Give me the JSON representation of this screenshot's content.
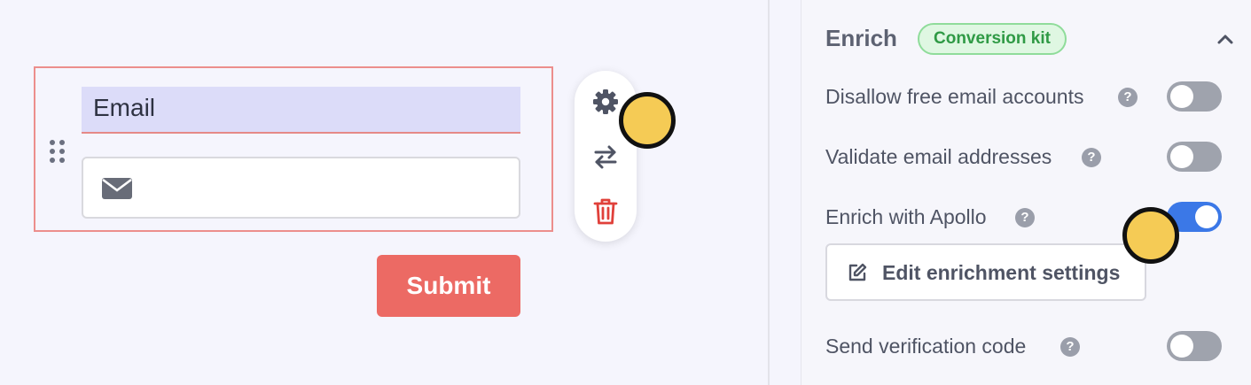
{
  "form": {
    "field_label": "Email",
    "input_value": "",
    "submit_label": "Submit"
  },
  "toolbar": {
    "icons": [
      "gear-icon",
      "swap-icon",
      "trash-icon"
    ]
  },
  "panel": {
    "title": "Enrich",
    "badge": "Conversion kit",
    "options": [
      {
        "label": "Disallow free email accounts",
        "help": "?",
        "enabled": false
      },
      {
        "label": "Validate email addresses",
        "help": "?",
        "enabled": false
      },
      {
        "label": "Enrich with Apollo",
        "help": "?",
        "enabled": true
      },
      {
        "label": "Send verification code",
        "help": "?",
        "enabled": false
      }
    ],
    "edit_button": "Edit enrichment settings"
  },
  "colors": {
    "accent_blue": "#3b78e7",
    "submit_red": "#ec6a64",
    "badge_green": "#2f9a45",
    "cursor_yellow": "#f5cb55"
  }
}
